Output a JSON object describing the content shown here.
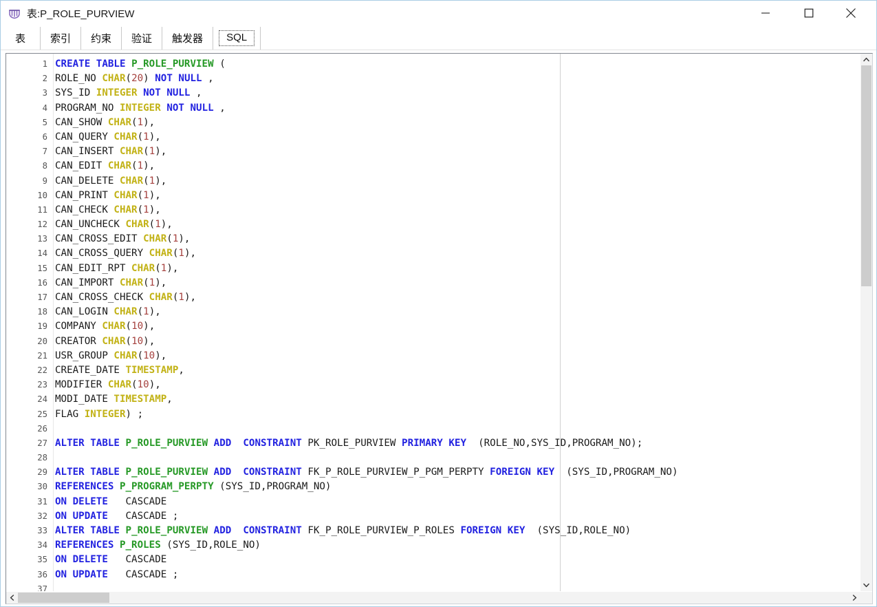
{
  "window": {
    "title": "表:P_ROLE_PURVIEW",
    "icon": "table-app-icon",
    "icon_color": "#8b6fc0",
    "controls": {
      "minimize": "minimize-icon",
      "maximize": "maximize-icon",
      "close": "close-icon"
    }
  },
  "tabs": [
    {
      "label": "表",
      "selected": false
    },
    {
      "label": "索引",
      "selected": false
    },
    {
      "label": "约束",
      "selected": false
    },
    {
      "label": "验证",
      "selected": false
    },
    {
      "label": "触发器",
      "selected": false
    },
    {
      "label": "SQL",
      "selected": true
    }
  ],
  "editor": {
    "colors": {
      "keyword": "#2222e0",
      "object_name": "#269926",
      "datatype": "#c2b216",
      "number": "#a5413e",
      "plain": "#1a1a1a",
      "gutter": "#555555",
      "background": "#ffffff",
      "margin_guide": "#d0d0d0"
    },
    "lines": [
      {
        "n": 1,
        "tokens": [
          [
            "k",
            "CREATE"
          ],
          [
            "p",
            " "
          ],
          [
            "k",
            "TABLE"
          ],
          [
            "p",
            " "
          ],
          [
            "t",
            "P_ROLE_PURVIEW"
          ],
          [
            "p",
            " ("
          ]
        ]
      },
      {
        "n": 2,
        "tokens": [
          [
            "p",
            "ROLE_NO "
          ],
          [
            "d",
            "CHAR"
          ],
          [
            "p",
            "("
          ],
          [
            "n",
            "20"
          ],
          [
            "p",
            ") "
          ],
          [
            "k",
            "NOT"
          ],
          [
            "p",
            " "
          ],
          [
            "k",
            "NULL"
          ],
          [
            "p",
            " ,"
          ]
        ]
      },
      {
        "n": 3,
        "tokens": [
          [
            "p",
            "SYS_ID "
          ],
          [
            "d",
            "INTEGER"
          ],
          [
            "p",
            " "
          ],
          [
            "k",
            "NOT"
          ],
          [
            "p",
            " "
          ],
          [
            "k",
            "NULL"
          ],
          [
            "p",
            " ,"
          ]
        ]
      },
      {
        "n": 4,
        "tokens": [
          [
            "p",
            "PROGRAM_NO "
          ],
          [
            "d",
            "INTEGER"
          ],
          [
            "p",
            " "
          ],
          [
            "k",
            "NOT"
          ],
          [
            "p",
            " "
          ],
          [
            "k",
            "NULL"
          ],
          [
            "p",
            " ,"
          ]
        ]
      },
      {
        "n": 5,
        "tokens": [
          [
            "p",
            "CAN_SHOW "
          ],
          [
            "d",
            "CHAR"
          ],
          [
            "p",
            "("
          ],
          [
            "n",
            "1"
          ],
          [
            "p",
            "),"
          ]
        ]
      },
      {
        "n": 6,
        "tokens": [
          [
            "p",
            "CAN_QUERY "
          ],
          [
            "d",
            "CHAR"
          ],
          [
            "p",
            "("
          ],
          [
            "n",
            "1"
          ],
          [
            "p",
            "),"
          ]
        ]
      },
      {
        "n": 7,
        "tokens": [
          [
            "p",
            "CAN_INSERT "
          ],
          [
            "d",
            "CHAR"
          ],
          [
            "p",
            "("
          ],
          [
            "n",
            "1"
          ],
          [
            "p",
            "),"
          ]
        ]
      },
      {
        "n": 8,
        "tokens": [
          [
            "p",
            "CAN_EDIT "
          ],
          [
            "d",
            "CHAR"
          ],
          [
            "p",
            "("
          ],
          [
            "n",
            "1"
          ],
          [
            "p",
            "),"
          ]
        ]
      },
      {
        "n": 9,
        "tokens": [
          [
            "p",
            "CAN_DELETE "
          ],
          [
            "d",
            "CHAR"
          ],
          [
            "p",
            "("
          ],
          [
            "n",
            "1"
          ],
          [
            "p",
            "),"
          ]
        ]
      },
      {
        "n": 10,
        "tokens": [
          [
            "p",
            "CAN_PRINT "
          ],
          [
            "d",
            "CHAR"
          ],
          [
            "p",
            "("
          ],
          [
            "n",
            "1"
          ],
          [
            "p",
            "),"
          ]
        ]
      },
      {
        "n": 11,
        "tokens": [
          [
            "p",
            "CAN_CHECK "
          ],
          [
            "d",
            "CHAR"
          ],
          [
            "p",
            "("
          ],
          [
            "n",
            "1"
          ],
          [
            "p",
            "),"
          ]
        ]
      },
      {
        "n": 12,
        "tokens": [
          [
            "p",
            "CAN_UNCHECK "
          ],
          [
            "d",
            "CHAR"
          ],
          [
            "p",
            "("
          ],
          [
            "n",
            "1"
          ],
          [
            "p",
            "),"
          ]
        ]
      },
      {
        "n": 13,
        "tokens": [
          [
            "p",
            "CAN_CROSS_EDIT "
          ],
          [
            "d",
            "CHAR"
          ],
          [
            "p",
            "("
          ],
          [
            "n",
            "1"
          ],
          [
            "p",
            "),"
          ]
        ]
      },
      {
        "n": 14,
        "tokens": [
          [
            "p",
            "CAN_CROSS_QUERY "
          ],
          [
            "d",
            "CHAR"
          ],
          [
            "p",
            "("
          ],
          [
            "n",
            "1"
          ],
          [
            "p",
            "),"
          ]
        ]
      },
      {
        "n": 15,
        "tokens": [
          [
            "p",
            "CAN_EDIT_RPT "
          ],
          [
            "d",
            "CHAR"
          ],
          [
            "p",
            "("
          ],
          [
            "n",
            "1"
          ],
          [
            "p",
            "),"
          ]
        ]
      },
      {
        "n": 16,
        "tokens": [
          [
            "p",
            "CAN_IMPORT "
          ],
          [
            "d",
            "CHAR"
          ],
          [
            "p",
            "("
          ],
          [
            "n",
            "1"
          ],
          [
            "p",
            "),"
          ]
        ]
      },
      {
        "n": 17,
        "tokens": [
          [
            "p",
            "CAN_CROSS_CHECK "
          ],
          [
            "d",
            "CHAR"
          ],
          [
            "p",
            "("
          ],
          [
            "n",
            "1"
          ],
          [
            "p",
            "),"
          ]
        ]
      },
      {
        "n": 18,
        "tokens": [
          [
            "p",
            "CAN_LOGIN "
          ],
          [
            "d",
            "CHAR"
          ],
          [
            "p",
            "("
          ],
          [
            "n",
            "1"
          ],
          [
            "p",
            "),"
          ]
        ]
      },
      {
        "n": 19,
        "tokens": [
          [
            "p",
            "COMPANY "
          ],
          [
            "d",
            "CHAR"
          ],
          [
            "p",
            "("
          ],
          [
            "n",
            "10"
          ],
          [
            "p",
            "),"
          ]
        ]
      },
      {
        "n": 20,
        "tokens": [
          [
            "p",
            "CREATOR "
          ],
          [
            "d",
            "CHAR"
          ],
          [
            "p",
            "("
          ],
          [
            "n",
            "10"
          ],
          [
            "p",
            "),"
          ]
        ]
      },
      {
        "n": 21,
        "tokens": [
          [
            "p",
            "USR_GROUP "
          ],
          [
            "d",
            "CHAR"
          ],
          [
            "p",
            "("
          ],
          [
            "n",
            "10"
          ],
          [
            "p",
            "),"
          ]
        ]
      },
      {
        "n": 22,
        "tokens": [
          [
            "p",
            "CREATE_DATE "
          ],
          [
            "d",
            "TIMESTAMP"
          ],
          [
            "p",
            ","
          ]
        ]
      },
      {
        "n": 23,
        "tokens": [
          [
            "p",
            "MODIFIER "
          ],
          [
            "d",
            "CHAR"
          ],
          [
            "p",
            "("
          ],
          [
            "n",
            "10"
          ],
          [
            "p",
            "),"
          ]
        ]
      },
      {
        "n": 24,
        "tokens": [
          [
            "p",
            "MODI_DATE "
          ],
          [
            "d",
            "TIMESTAMP"
          ],
          [
            "p",
            ","
          ]
        ]
      },
      {
        "n": 25,
        "tokens": [
          [
            "p",
            "FLAG "
          ],
          [
            "d",
            "INTEGER"
          ],
          [
            "p",
            ") ;"
          ]
        ]
      },
      {
        "n": 26,
        "tokens": []
      },
      {
        "n": 27,
        "tokens": [
          [
            "k",
            "ALTER"
          ],
          [
            "p",
            " "
          ],
          [
            "k",
            "TABLE"
          ],
          [
            "p",
            " "
          ],
          [
            "t",
            "P_ROLE_PURVIEW"
          ],
          [
            "p",
            " "
          ],
          [
            "k",
            "ADD"
          ],
          [
            "p",
            "  "
          ],
          [
            "k",
            "CONSTRAINT"
          ],
          [
            "p",
            " PK_ROLE_PURVIEW "
          ],
          [
            "k",
            "PRIMARY"
          ],
          [
            "p",
            " "
          ],
          [
            "k",
            "KEY"
          ],
          [
            "p",
            "  (ROLE_NO,SYS_ID,PROGRAM_NO);"
          ]
        ]
      },
      {
        "n": 28,
        "tokens": []
      },
      {
        "n": 29,
        "tokens": [
          [
            "k",
            "ALTER"
          ],
          [
            "p",
            " "
          ],
          [
            "k",
            "TABLE"
          ],
          [
            "p",
            " "
          ],
          [
            "t",
            "P_ROLE_PURVIEW"
          ],
          [
            "p",
            " "
          ],
          [
            "k",
            "ADD"
          ],
          [
            "p",
            "  "
          ],
          [
            "k",
            "CONSTRAINT"
          ],
          [
            "p",
            " FK_P_ROLE_PURVIEW_P_PGM_PERPTY "
          ],
          [
            "k",
            "FOREIGN"
          ],
          [
            "p",
            " "
          ],
          [
            "k",
            "KEY"
          ],
          [
            "p",
            "  (SYS_ID,PROGRAM_NO)"
          ]
        ]
      },
      {
        "n": 30,
        "tokens": [
          [
            "k",
            "REFERENCES"
          ],
          [
            "p",
            " "
          ],
          [
            "t",
            "P_PROGRAM_PERPTY"
          ],
          [
            "p",
            " (SYS_ID,PROGRAM_NO)"
          ]
        ]
      },
      {
        "n": 31,
        "tokens": [
          [
            "k",
            "ON"
          ],
          [
            "p",
            " "
          ],
          [
            "k",
            "DELETE"
          ],
          [
            "p",
            "   CASCADE"
          ]
        ]
      },
      {
        "n": 32,
        "tokens": [
          [
            "k",
            "ON"
          ],
          [
            "p",
            " "
          ],
          [
            "k",
            "UPDATE"
          ],
          [
            "p",
            "   CASCADE ;"
          ]
        ]
      },
      {
        "n": 33,
        "tokens": [
          [
            "k",
            "ALTER"
          ],
          [
            "p",
            " "
          ],
          [
            "k",
            "TABLE"
          ],
          [
            "p",
            " "
          ],
          [
            "t",
            "P_ROLE_PURVIEW"
          ],
          [
            "p",
            " "
          ],
          [
            "k",
            "ADD"
          ],
          [
            "p",
            "  "
          ],
          [
            "k",
            "CONSTRAINT"
          ],
          [
            "p",
            " FK_P_ROLE_PURVIEW_P_ROLES "
          ],
          [
            "k",
            "FOREIGN"
          ],
          [
            "p",
            " "
          ],
          [
            "k",
            "KEY"
          ],
          [
            "p",
            "  (SYS_ID,ROLE_NO)"
          ]
        ]
      },
      {
        "n": 34,
        "tokens": [
          [
            "k",
            "REFERENCES"
          ],
          [
            "p",
            " "
          ],
          [
            "t",
            "P_ROLES"
          ],
          [
            "p",
            " (SYS_ID,ROLE_NO)"
          ]
        ]
      },
      {
        "n": 35,
        "tokens": [
          [
            "k",
            "ON"
          ],
          [
            "p",
            " "
          ],
          [
            "k",
            "DELETE"
          ],
          [
            "p",
            "   CASCADE"
          ]
        ]
      },
      {
        "n": 36,
        "tokens": [
          [
            "k",
            "ON"
          ],
          [
            "p",
            " "
          ],
          [
            "k",
            "UPDATE"
          ],
          [
            "p",
            "   CASCADE ;"
          ]
        ]
      },
      {
        "n": 37,
        "tokens": []
      }
    ]
  },
  "scrollbars": {
    "vertical": {
      "up_arrow": "chevron-up-icon",
      "down_arrow": "chevron-down-icon",
      "thumb_top_pct": 0,
      "thumb_height_pct": 43
    },
    "horizontal": {
      "left_arrow": "chevron-left-icon",
      "right_arrow": "chevron-right-icon",
      "thumb_left_pct": 0,
      "thumb_width_pct": 11
    }
  }
}
